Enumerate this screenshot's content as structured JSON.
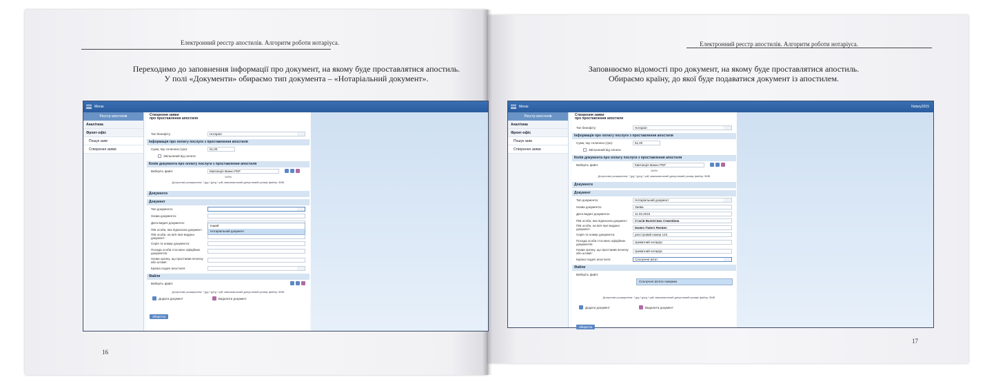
{
  "spread": {
    "running_head_left": "Електронний реєстр апостилів. Алгоритм роботи нотаріуса.",
    "running_head_right": "Електронний реєстр апостилів. Алгоритм роботи нотаріуса.",
    "page_number_left": "16",
    "page_number_right": "17",
    "caption_left_line1": "Переходимо до заповнення інформації про документ, на якому буде проставлятися апостиль.",
    "caption_left_line2": "У полі «Документи» обираємо тип документа – «Нотаріальний документ».",
    "caption_right_line1": "Заповнюємо відомості про документ, на якому буде проставлятися апостиль.",
    "caption_right_line2": "Обираємо країну, до якої буде подаватися документ із апостилем."
  },
  "app": {
    "menu_label": "Меню",
    "user_label": "Notary2015",
    "sidebar": {
      "header": "Реєстр апостилів",
      "items": [
        "Аналітика",
        "Фронт-офіс",
        "Пошук заяв",
        "Створення заяви"
      ]
    },
    "form": {
      "tab1": "Створення заяви",
      "tab2": "про проставлення апостиля",
      "type_label": "Тип бенефіту:",
      "type_value": "Нотаріат",
      "payment_section": "Інформація про оплату послуги з проставлення апостиля",
      "amount_label": "Сума, яку сплачено (грн):",
      "amount_value": "51,00",
      "exempt_label": "Звільнений від оплати",
      "copy_section": "Копія документа про оплату послуги з проставлення апостиля",
      "choose_file_label": "Виберіть файл:",
      "file_value": "Квитанція Іванко PDF",
      "progress_text": "100%",
      "allowed_note": "Допустимі розширення: *.jpg *.jpeg *.pdf; максимальний допустимий розмір файлу: 5МБ",
      "documents_section": "Документи",
      "document_subsection": "Документ",
      "doc_type_label": "Тип документа:",
      "doc_name_label": "Назва документа:",
      "doc_date_label": "Дата видачі документа:",
      "signer_label": "ПІБ особи, яка підписала документ:",
      "issuer_name_label": "ПІБ особи, на ім'я якої видано документ:",
      "series_label": "Серія та номер документа:",
      "position_label": "Посада особи стосовно офіційних документів:",
      "authority_label": "Назва органу, що проставив печатку або штамп:",
      "country_label": "Країна подачі апостиля:",
      "files_section": "Файли",
      "add_doc": "Додати документ",
      "remove_doc": "Видалити документ",
      "save_button": "Зберегти",
      "dropdown_left": [
        "Інший",
        "Нотаріальний документ"
      ],
      "right_values": {
        "doc_type": "Нотаріальний документ",
        "doc_name": "Заява",
        "doc_date": "11.03.2015",
        "signer": "Стасів Валентина Семенівна",
        "issuer_name": "Іванко Павел Якович",
        "series": "реєстровий номер 143",
        "position": "приватний нотаріус",
        "authority": "приватний нотаріус",
        "country": "Сполучені Штат",
        "country_option": "Сполучені Штати Америки"
      }
    }
  }
}
